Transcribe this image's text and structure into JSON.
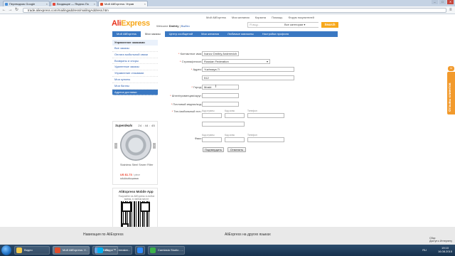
{
  "browser": {
    "tabs": [
      {
        "label": "Переводчик Google",
        "active": false
      },
      {
        "label": "Входящие — Яндекс.По",
        "active": false
      },
      {
        "label": "Мой AliExpress: Управ",
        "active": true
      }
    ],
    "url": "trade.aliexpress.com/mailingaddress/mailingAddress.htm",
    "controls": {
      "minimize": "–",
      "maximize": "□",
      "close": "✕"
    },
    "nav": {
      "back": "←",
      "forward": "→",
      "reload": "↻",
      "menu": "≡"
    }
  },
  "site": {
    "topnav": [
      "Мой AliExpress",
      "Мои желания",
      "Корзина",
      "Помощь",
      "Форум покупателей"
    ],
    "logo_main": "Ali",
    "logo_accent": "Express",
    "welcome_prefix": "Welcome",
    "user_name": "Dmitriy",
    "exit_label": "Выйти",
    "search_placeholder": "Я ищу...",
    "search_category": "Все категории",
    "search_button": "Search"
  },
  "mainnav": [
    {
      "label": "Мой AliExpress",
      "active": false
    },
    {
      "label": "Мои заказы",
      "active": true
    },
    {
      "label": "Центр сообщений",
      "active": false
    },
    {
      "label": "Мои желания",
      "active": false
    },
    {
      "label": "Любимые магазины",
      "active": false
    },
    {
      "label": "Настройки профиля",
      "active": false
    }
  ],
  "sidebar": {
    "heading": "Управление заказами",
    "items": [
      {
        "label": "Все заказы",
        "active": false
      },
      {
        "label": "Оплата мобильной связи",
        "active": false
      },
      {
        "label": "Возвраты и споры",
        "active": false
      },
      {
        "label": "Удаленные заказы",
        "active": false
      },
      {
        "label": "Управление отзывами",
        "active": false
      },
      {
        "label": "Мои купоны",
        "active": false
      },
      {
        "label": "Мои баллы",
        "active": false
      },
      {
        "label": "Адреса доставки",
        "active": true
      }
    ]
  },
  "superdeals": {
    "title": "Superdeals",
    "timer": "24 : 44 : 45",
    "product_name": "Stainless Steel Sewer Filter",
    "price": "US $1.73",
    "price_unit": "/ piece",
    "old_price": "US $4.65 / piece",
    "prev": "‹",
    "next": "›"
  },
  "mobile_app": {
    "title": "AliExpress Mobile App",
    "description": "Покупайте на AliExpress в любое время, в любом месте",
    "link": "Scan or click to download"
  },
  "form": {
    "contact_label": "Контактное имя:",
    "contact_value": "Ivanov Dmitriy Andreevich",
    "country_label": "Страна/регион:",
    "country_value": "Russian Federation",
    "address_label": "Адрес:",
    "address1_value": "Yuzhnaya 7/",
    "address2_value": "512",
    "city_label": "Город:",
    "city_value": "Moski",
    "state_label": "Штат/провинция/округ:",
    "state_value": "",
    "zip_label": "Почтовый индекс/код:",
    "zip_value": "",
    "phone_label": "Тел./мобильный тел.:",
    "phone_sub": [
      "Код страны",
      "Код зоны",
      "Телефон"
    ],
    "fax_label": "Факс:",
    "fax_sub": [
      "Код страны",
      "Код зоны",
      "Телефон"
    ],
    "confirm_button": "Подтвердить",
    "cancel_button": "Отменить",
    "required_mark": "*"
  },
  "feedback": {
    "label": "Отзывы клиентов",
    "icon": "☺"
  },
  "footer": {
    "nav_heading": "Навигация по AliExpress",
    "other_lang_heading": "AliExpress на других языках",
    "windows_notice": [
      "Сбор",
      "Доступ к Интернету"
    ]
  },
  "taskbar": {
    "items": [
      {
        "label": "Видео",
        "color": "#f2c94c"
      },
      {
        "label": "Мой AliExpress: У...",
        "color": "#e04d2b",
        "active": true
      },
      {
        "label": "Файл",
        "color": "#4a90d9"
      },
      {
        "label": "Skype™ - breaker...",
        "color": "#00aff0"
      },
      {
        "label": "",
        "color": "#2d8cff"
      },
      {
        "label": "Camtasia Studio - ...",
        "color": "#3cb04a"
      }
    ],
    "lang": "RU",
    "time": "19:10",
    "date": "16.08.2015"
  }
}
